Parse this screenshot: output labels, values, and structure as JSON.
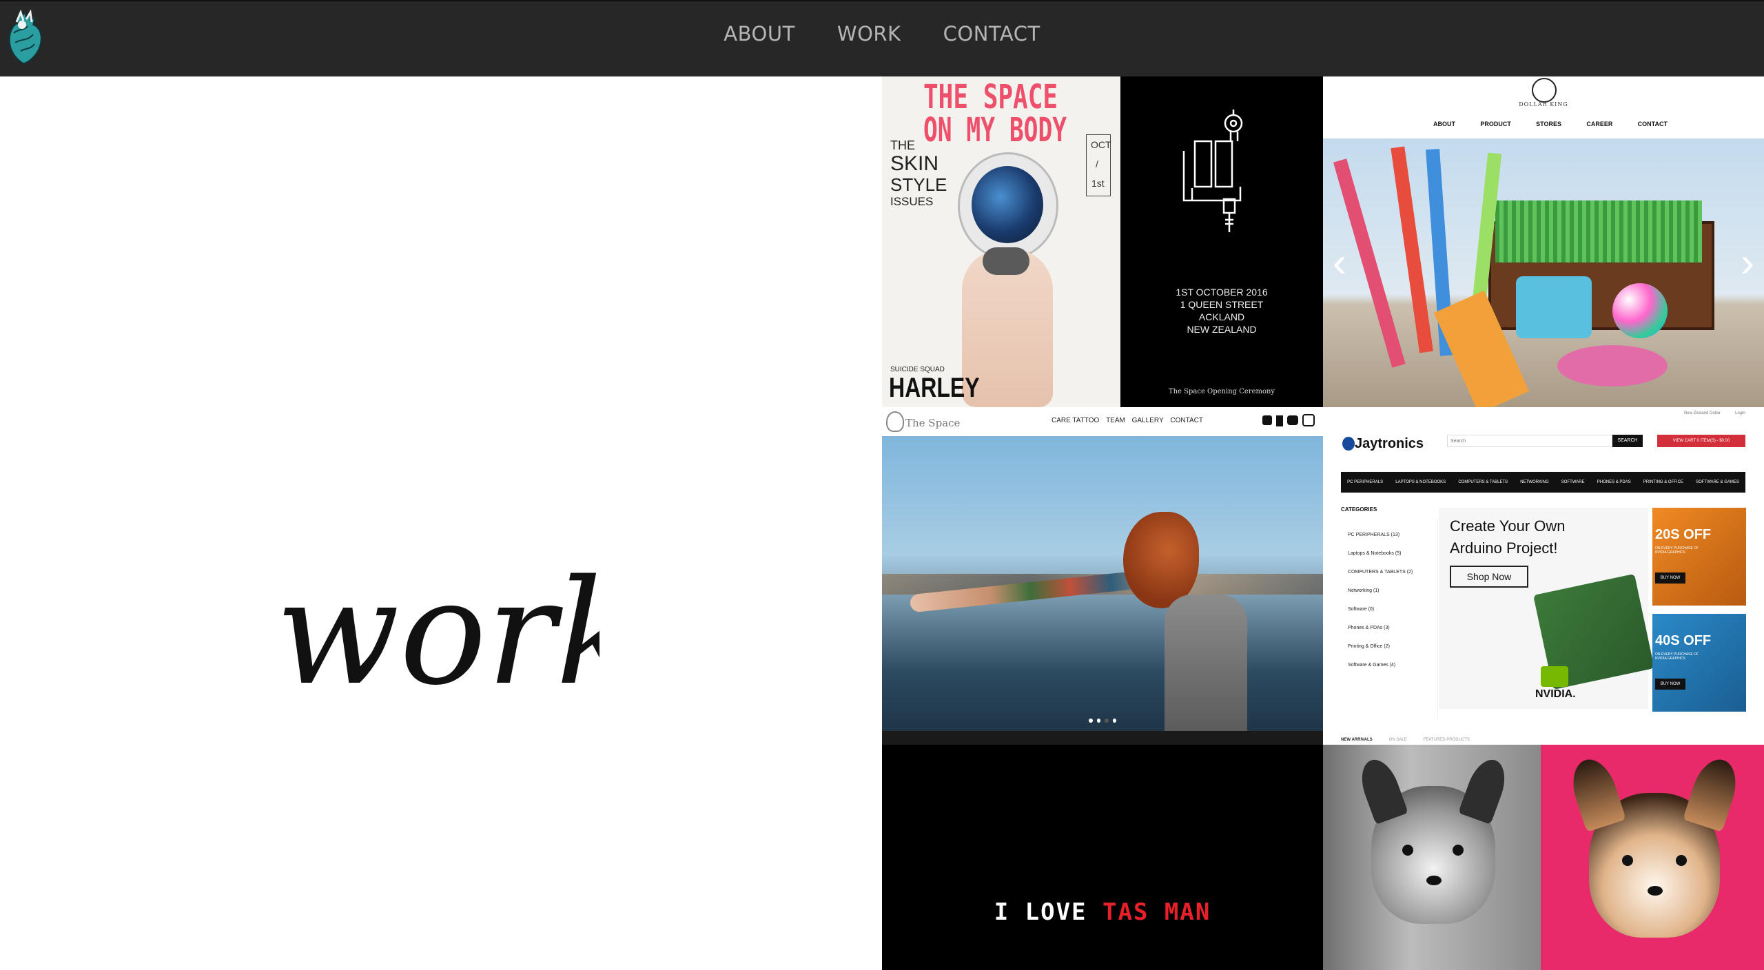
{
  "nav": {
    "items": [
      "ABOUT",
      "WORK",
      "CONTACT"
    ]
  },
  "hero": {
    "title": "work"
  },
  "tiles": {
    "space_poster": {
      "headline_1": "THE SPACE",
      "headline_2": "ON MY BODY",
      "side_1": "THE",
      "side_2": "SKIN",
      "side_3": "STYLE",
      "side_4": "ISSUES",
      "date_1": "OCT",
      "date_2": "/",
      "date_3": "1st",
      "quinn_sub": "SUICIDE SQUAD",
      "quinn": "HARLEY",
      "addr_1": "1ST  OCTOBER 2016",
      "addr_2": "1 QUEEN STREET",
      "addr_3": "ACKLAND",
      "addr_4": "NEW ZEALAND",
      "caption": "The Space Opening Ceremony"
    },
    "dollar_king": {
      "brand": "DOLLAR KING",
      "nav": [
        "ABOUT",
        "PRODUCT",
        "STORES",
        "CAREER",
        "CONTACT"
      ],
      "prev": "‹",
      "next": "›"
    },
    "the_space_site": {
      "brand": "The Space",
      "nav": [
        "CARE TATTOO",
        "TEAM",
        "GALLERY",
        "CONTACT"
      ]
    },
    "jaytronics": {
      "top_links": [
        "New Zealand Dollar",
        "Login"
      ],
      "brand": "Jaytronics",
      "search_placeholder": "Search",
      "search_button": "SEARCH",
      "cart": "VIEW CART  0 ITEM(S) - $0.00",
      "categories_nav": [
        "PC PERIPHERALS",
        "LAPTOPS & NOTEBOOKS",
        "COMPUTERS & TABLETS",
        "NETWORKING",
        "SOFTWARE",
        "PHONES & PDAS",
        "PRINTING & OFFICE",
        "SOFTWARE & GAMES"
      ],
      "categories_title": "CATEGORIES",
      "categories": [
        "PC PERIPHERALS (13)",
        "Laptops & Notebooks (5)",
        "COMPUTERS & TABLETS (2)",
        "Networking (1)",
        "Software (0)",
        "Phones & PDAs (3)",
        "Printing & Office (2)",
        "Software & Games (4)"
      ],
      "banner_1": "Create Your Own",
      "banner_2": "Arduino Project!",
      "shop_now": "Shop Now",
      "nvidia": "NVIDIA.",
      "promo_1": "20S OFF",
      "promo_2": "40S OFF",
      "promo_sub": "ON EVERY PURCHASE OF NVIDIA GRAPHICS",
      "buy_now": "BUY NOW",
      "tabs": [
        "NEW ARRIVALS",
        "ON SALE",
        "FEATURED PRODUCTS"
      ]
    },
    "tasman": {
      "part_1": "I LOVE ",
      "part_2": "TAS MAN"
    }
  },
  "colors": {
    "nav_bg": "#272727",
    "nav_text": "#b5b5b5",
    "poster_pink": "#ee4f6a",
    "jay_red": "#d22f3a",
    "tasman_red": "#e8202a"
  }
}
